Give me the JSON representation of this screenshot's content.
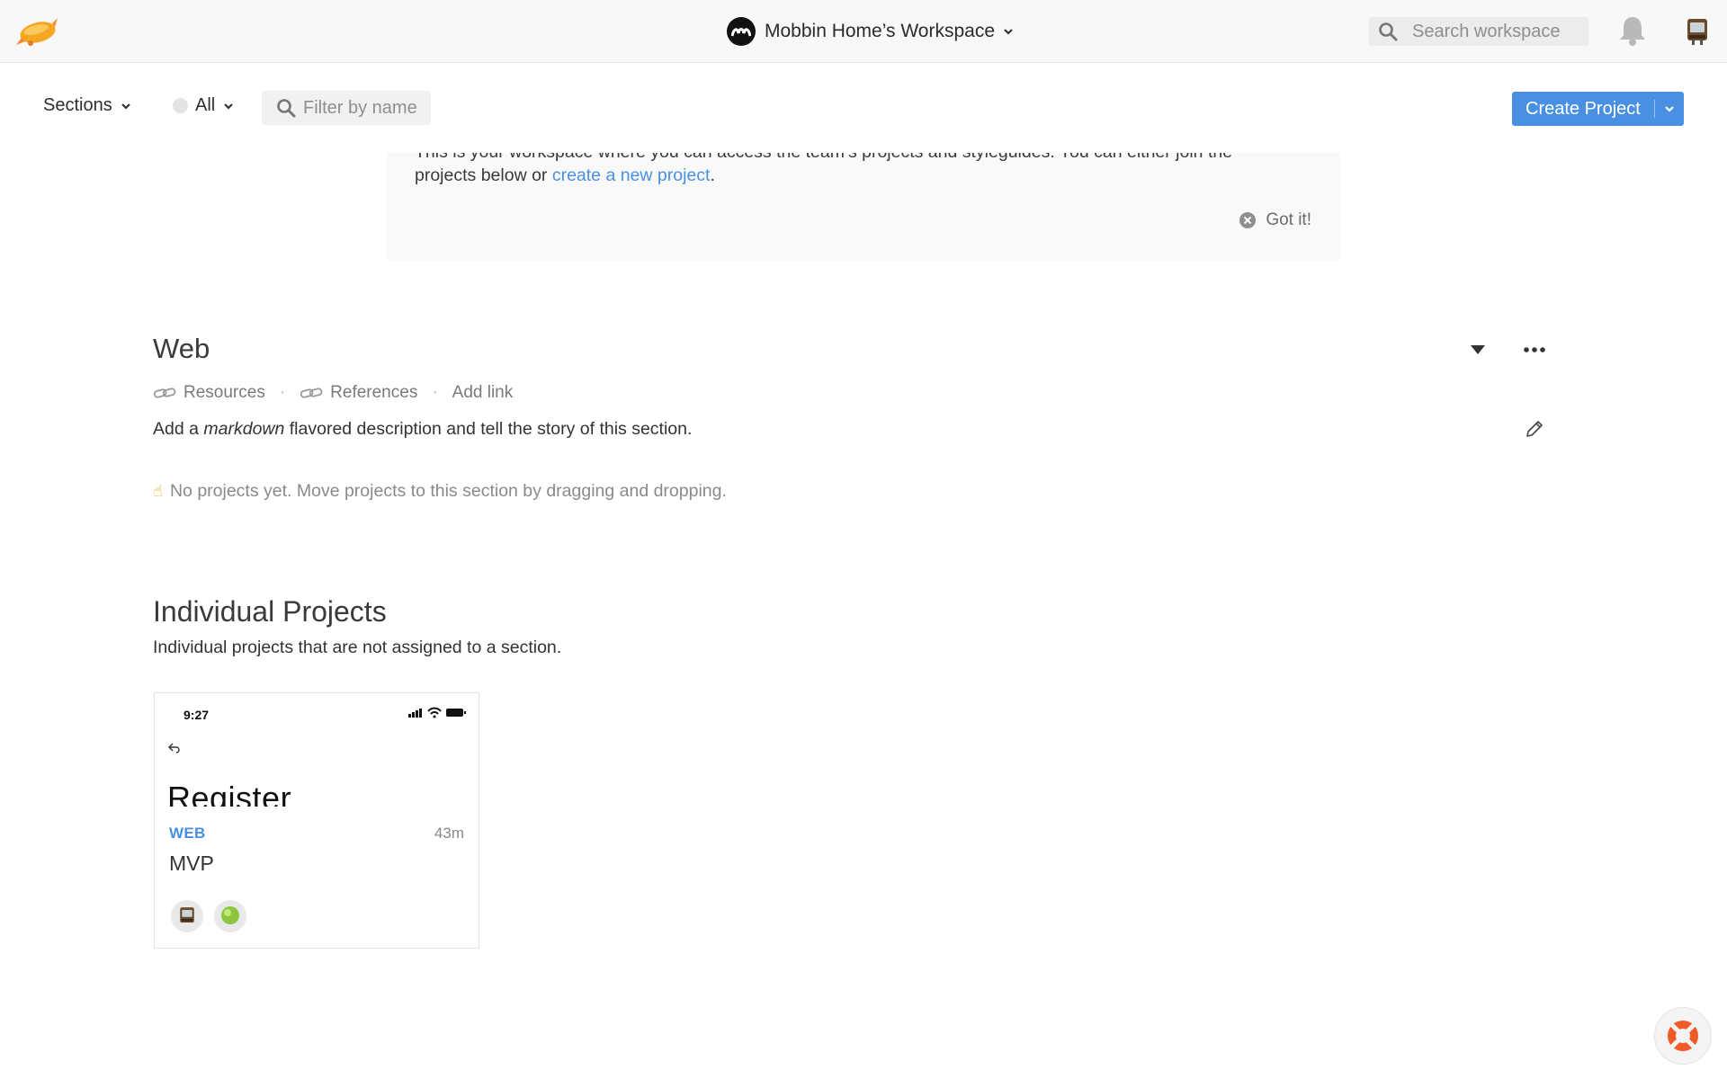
{
  "header": {
    "workspace_name": "Mobbin Home’s Workspace",
    "search_placeholder": "Search workspace"
  },
  "toolbar": {
    "sections_label": "Sections",
    "all_label": "All",
    "filter_placeholder": "Filter by name",
    "create_label": "Create Project"
  },
  "banner": {
    "line1": "This is your workspace where you can access the team’s projects and styleguides. You can either join the",
    "line2_prefix": "projects below or ",
    "link_text": "create a new project",
    "line2_suffix": ".",
    "dismiss_label": "Got it!"
  },
  "web_section": {
    "title": "Web",
    "links": [
      "Resources",
      "References",
      "Add link"
    ],
    "desc_prefix": "Add a ",
    "desc_em": "markdown",
    "desc_suffix": " flavored description and tell the story of this section.",
    "empty_note": "No projects yet. Move projects to this section by dragging and dropping."
  },
  "individual": {
    "title": "Individual Projects",
    "desc": "Individual projects that are not assigned to a section.",
    "projects": [
      {
        "thumb_time": "9:27",
        "thumb_heading": "Register",
        "tag": "WEB",
        "age": "43m",
        "name": "MVP"
      }
    ]
  },
  "colors": {
    "accent": "#4a90e2",
    "topbar_bg": "#f8f8f8",
    "banner_bg": "#f9f9f9",
    "muted_text": "#8a8a8a"
  },
  "icons": [
    "zeplin-logo-icon",
    "workspace-avatar-icon",
    "chevron-down-icon",
    "search-icon",
    "bell-icon",
    "user-avatar-icon",
    "close-circle-icon",
    "link-icon",
    "caret-down-icon",
    "more-icon",
    "pencil-icon",
    "pointing-hand-icon",
    "lifebuoy-icon"
  ]
}
